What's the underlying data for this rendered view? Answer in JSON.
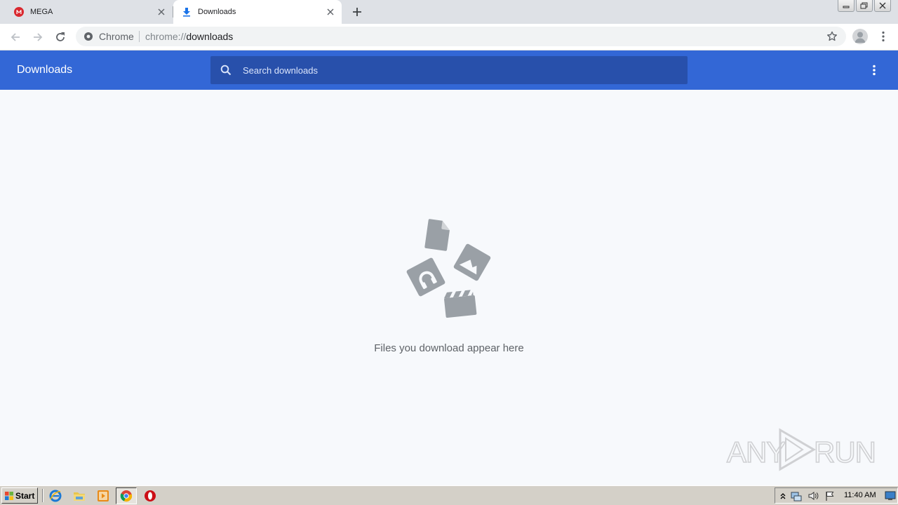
{
  "browser": {
    "tabs": [
      {
        "title": "MEGA",
        "favicon": "mega-icon",
        "active": false
      },
      {
        "title": "Downloads",
        "favicon": "download-icon",
        "active": true
      }
    ],
    "omnibox": {
      "origin_label": "Chrome",
      "url_scheme": "chrome://",
      "url_host": "downloads"
    }
  },
  "downloads_page": {
    "title": "Downloads",
    "search_placeholder": "Search downloads",
    "empty_message": "Files you download appear here"
  },
  "watermark": {
    "left_text": "ANY",
    "right_text": "RUN"
  },
  "taskbar": {
    "start_label": "Start",
    "pinned": [
      "internet-explorer-icon",
      "explorer-folder-icon",
      "media-player-icon",
      "chrome-icon",
      "opera-icon"
    ],
    "clock": "11:40 AM"
  },
  "colors": {
    "header_blue": "#3367d6",
    "search_blue": "#2850ab",
    "page_bg": "#f7f9fc",
    "tabstrip": "#dee1e6",
    "illustration_gray": "#9aa0a6"
  }
}
